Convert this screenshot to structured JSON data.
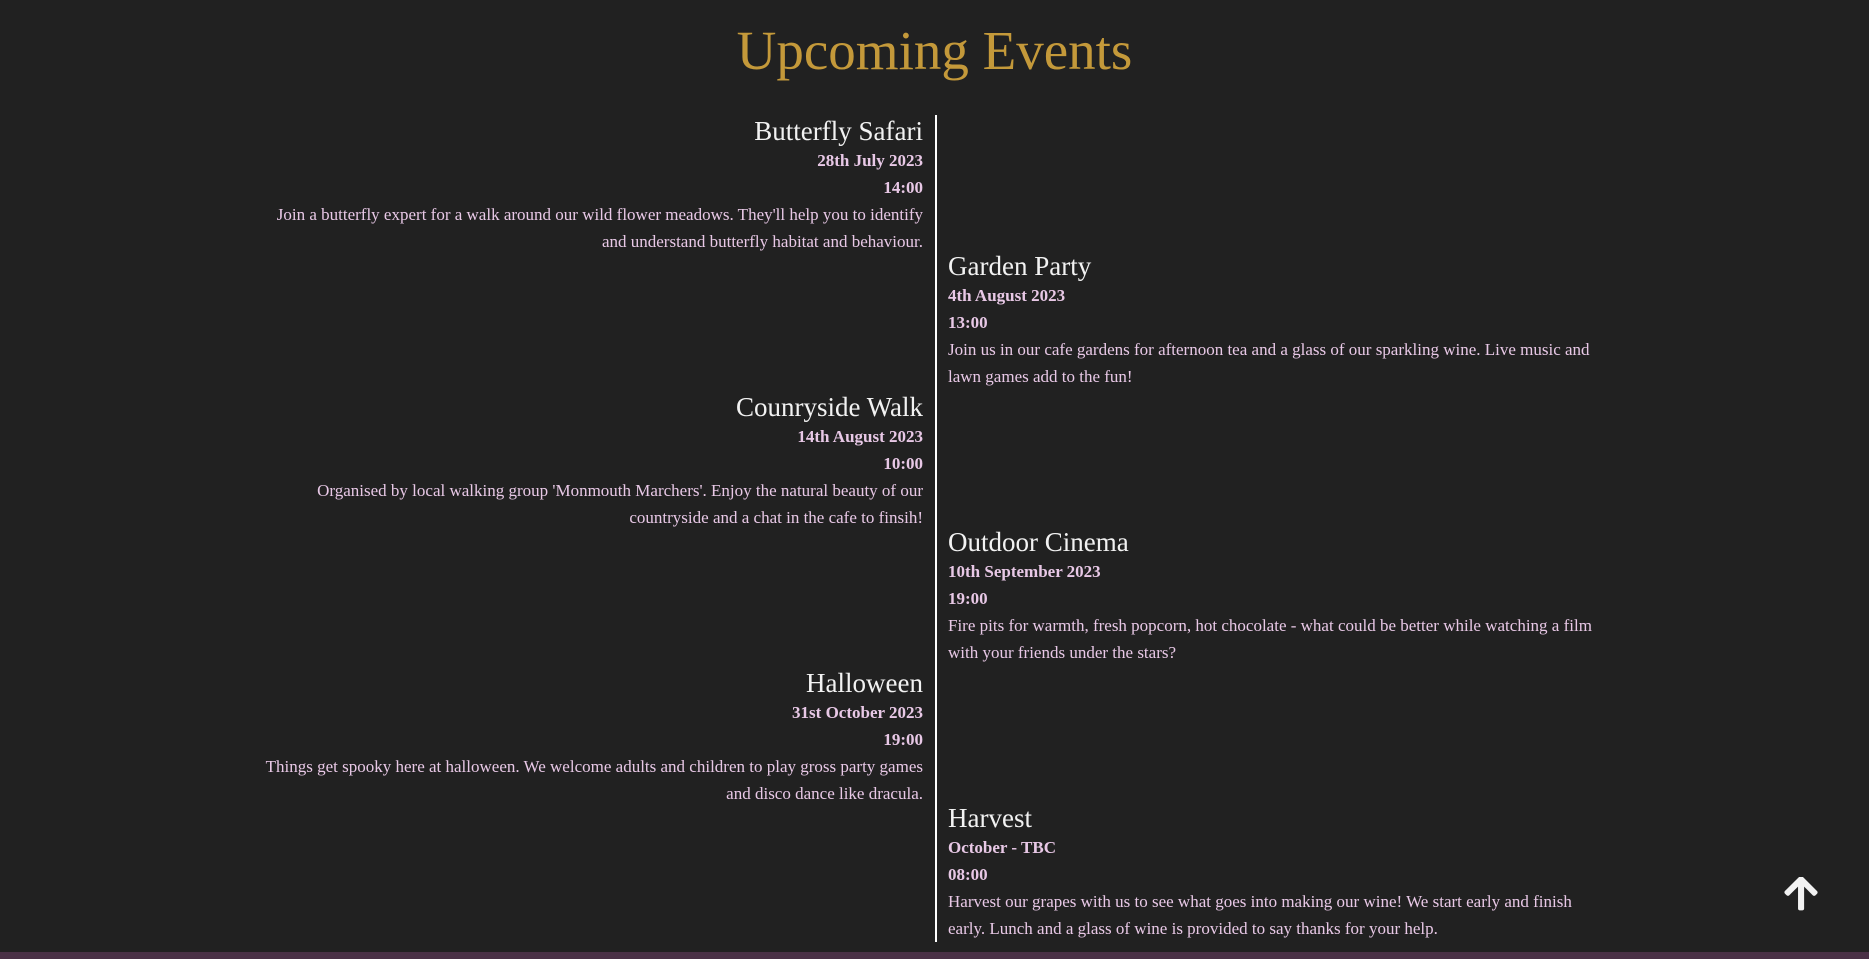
{
  "page": {
    "title": "Upcoming Events"
  },
  "events": [
    {
      "name": "Butterfly Safari",
      "date": "28th July 2023",
      "time": "14:00",
      "description": "Join a butterfly expert for a walk around our wild flower meadows. They'll help you to identify and understand butterfly habitat and behaviour."
    },
    {
      "name": "Garden Party",
      "date": "4th August 2023",
      "time": "13:00",
      "description": "Join us in our cafe gardens for afternoon tea and a glass of our sparkling wine. Live music and lawn games add to the fun!"
    },
    {
      "name": "Counryside Walk",
      "date": "14th August 2023",
      "time": "10:00",
      "description": "Organised by local walking group 'Monmouth Marchers'. Enjoy the natural beauty of our countryside and a chat in the cafe to finsih!"
    },
    {
      "name": "Outdoor Cinema",
      "date": "10th September 2023",
      "time": "19:00",
      "description": "Fire pits for warmth, fresh popcorn, hot chocolate - what could be better while watching a film with your friends under the stars?"
    },
    {
      "name": "Halloween",
      "date": "31st October 2023",
      "time": "19:00",
      "description": "Things get spooky here at halloween. We welcome adults and children to play gross party games and disco dance like dracula."
    },
    {
      "name": "Harvest",
      "date": "October - TBC",
      "time": "08:00",
      "description": "Harvest our grapes with us to see what goes into making our wine! We start early and finish early. Lunch and a glass of wine is provided to say thanks for your help."
    }
  ],
  "icons": {
    "scroll_top": "arrow-up-icon"
  },
  "colors": {
    "background": "#212121",
    "title": "#c4993a",
    "event_name": "#f2f2f2",
    "event_text": "#e8c8e6",
    "timeline": "#ffffff",
    "footer": "#4a3146"
  }
}
